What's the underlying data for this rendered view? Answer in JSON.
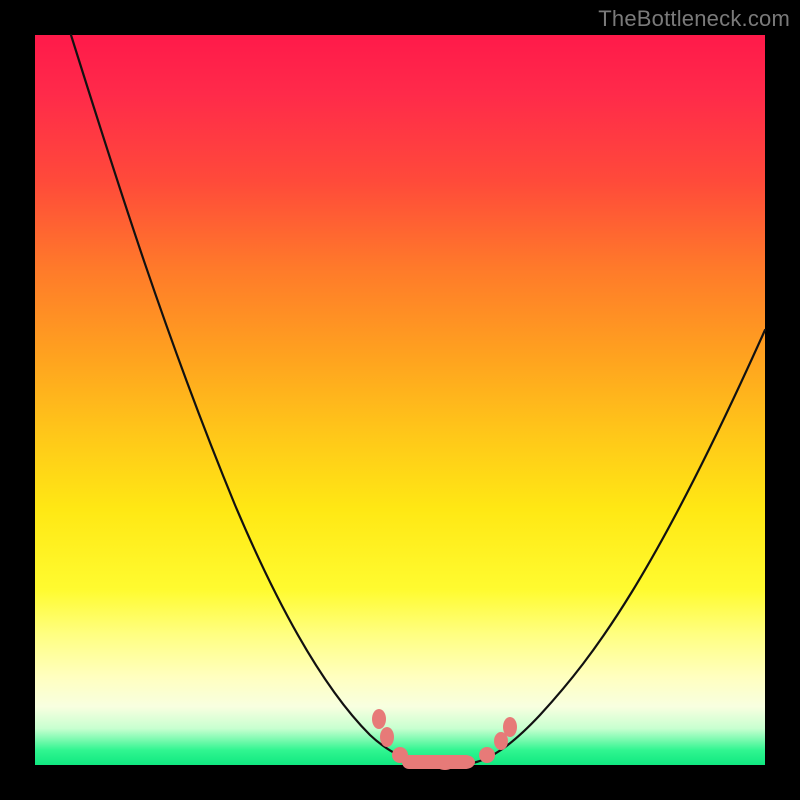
{
  "watermark": "TheBottleneck.com",
  "colors": {
    "frame_bg": "#000000",
    "marker": "#e77a78",
    "curve": "#111111",
    "gradient_top": "#ff1a4a",
    "gradient_bottom": "#10e880"
  },
  "chart_data": {
    "type": "line",
    "title": "",
    "xlabel": "",
    "ylabel": "",
    "xlim": [
      0,
      100
    ],
    "ylim": [
      0,
      100
    ],
    "grid": false,
    "legend": false,
    "series": [
      {
        "name": "left-curve",
        "x": [
          5,
          10,
          15,
          20,
          25,
          30,
          35,
          40,
          45,
          48,
          50,
          52
        ],
        "y": [
          100,
          88,
          75,
          63,
          50,
          38,
          27,
          17,
          8,
          3,
          1,
          0
        ]
      },
      {
        "name": "right-curve",
        "x": [
          60,
          63,
          66,
          70,
          75,
          80,
          85,
          90,
          95,
          100
        ],
        "y": [
          0,
          1,
          3,
          6,
          12,
          20,
          30,
          40,
          50,
          60
        ]
      }
    ],
    "markers": {
      "name": "highlight-points",
      "points": [
        {
          "x": 47,
          "y": 6.5
        },
        {
          "x": 48,
          "y": 4
        },
        {
          "x": 50,
          "y": 1
        },
        {
          "x": 53,
          "y": 0
        },
        {
          "x": 56,
          "y": 0
        },
        {
          "x": 59,
          "y": 0
        },
        {
          "x": 62,
          "y": 1
        },
        {
          "x": 64,
          "y": 3
        },
        {
          "x": 65,
          "y": 5
        }
      ],
      "capsule": {
        "x0": 50,
        "x1": 60,
        "y": 0
      }
    },
    "annotations": [
      {
        "text": "TheBottleneck.com",
        "pos": "top-right"
      }
    ]
  }
}
